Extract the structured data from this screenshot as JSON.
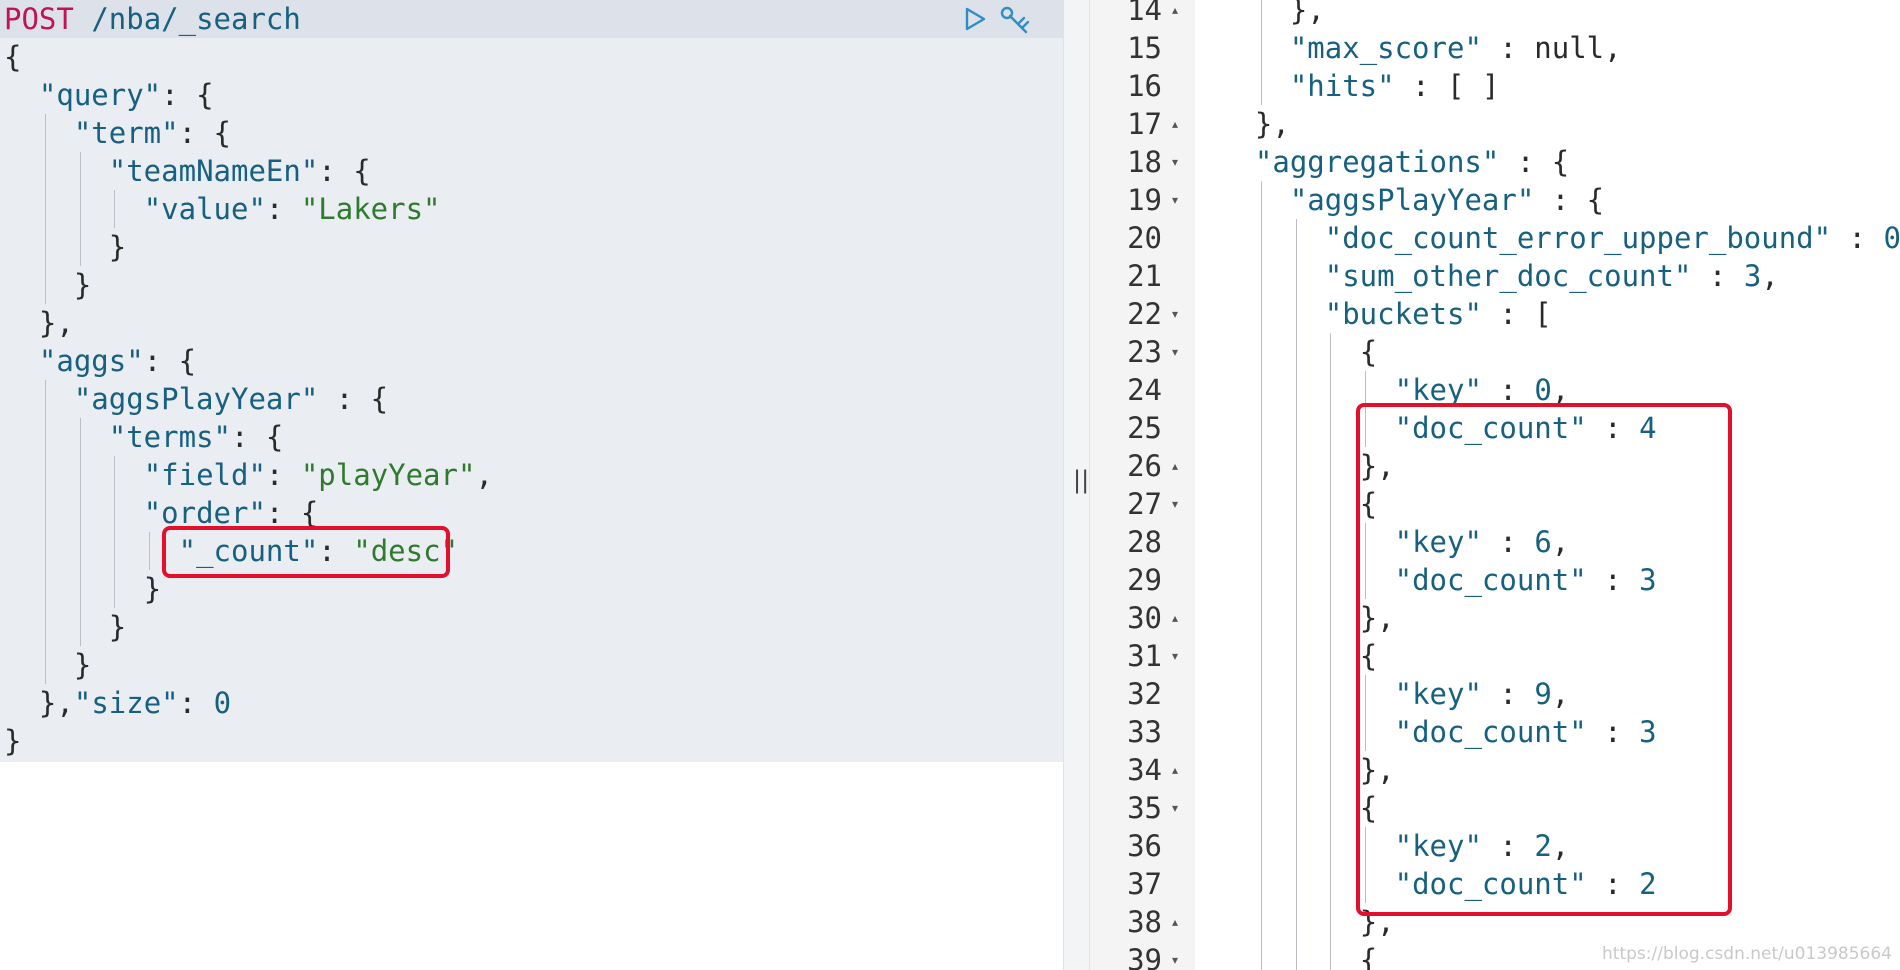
{
  "request": {
    "method": "POST",
    "path": "/nba/_search",
    "lines": [
      "{",
      "  \"query\": {",
      "    \"term\": {",
      "      \"teamNameEn\": {",
      "        \"value\": \"Lakers\"",
      "      }",
      "    }",
      "  },",
      "  \"aggs\": {",
      "    \"aggsPlayYear\" : {",
      "      \"terms\": {",
      "        \"field\": \"playYear\",",
      "        \"order\": {",
      "          \"_count\": \"desc\"",
      "        }",
      "      }",
      "    }",
      "  },\"size\": 0",
      "}"
    ]
  },
  "response": {
    "lines": [
      {
        "no": "14",
        "fold": "▴",
        "text": "    },"
      },
      {
        "no": "15",
        "fold": "",
        "text": "    \"max_score\" : null,"
      },
      {
        "no": "16",
        "fold": "",
        "text": "    \"hits\" : [ ]"
      },
      {
        "no": "17",
        "fold": "▴",
        "text": "  },"
      },
      {
        "no": "18",
        "fold": "▾",
        "text": "  \"aggregations\" : {"
      },
      {
        "no": "19",
        "fold": "▾",
        "text": "    \"aggsPlayYear\" : {"
      },
      {
        "no": "20",
        "fold": "",
        "text": "      \"doc_count_error_upper_bound\" : 0,"
      },
      {
        "no": "21",
        "fold": "",
        "text": "      \"sum_other_doc_count\" : 3,"
      },
      {
        "no": "22",
        "fold": "▾",
        "text": "      \"buckets\" : ["
      },
      {
        "no": "23",
        "fold": "▾",
        "text": "        {"
      },
      {
        "no": "24",
        "fold": "",
        "text": "          \"key\" : 0,"
      },
      {
        "no": "25",
        "fold": "",
        "text": "          \"doc_count\" : 4"
      },
      {
        "no": "26",
        "fold": "▴",
        "text": "        },"
      },
      {
        "no": "27",
        "fold": "▾",
        "text": "        {"
      },
      {
        "no": "28",
        "fold": "",
        "text": "          \"key\" : 6,"
      },
      {
        "no": "29",
        "fold": "",
        "text": "          \"doc_count\" : 3"
      },
      {
        "no": "30",
        "fold": "▴",
        "text": "        },"
      },
      {
        "no": "31",
        "fold": "▾",
        "text": "        {"
      },
      {
        "no": "32",
        "fold": "",
        "text": "          \"key\" : 9,"
      },
      {
        "no": "33",
        "fold": "",
        "text": "          \"doc_count\" : 3"
      },
      {
        "no": "34",
        "fold": "▴",
        "text": "        },"
      },
      {
        "no": "35",
        "fold": "▾",
        "text": "        {"
      },
      {
        "no": "36",
        "fold": "",
        "text": "          \"key\" : 2,"
      },
      {
        "no": "37",
        "fold": "",
        "text": "          \"doc_count\" : 2"
      },
      {
        "no": "38",
        "fold": "▴",
        "text": "        },"
      },
      {
        "no": "39",
        "fold": "▾",
        "text": "        {"
      }
    ]
  },
  "divider_glyph": "||",
  "watermark": "https://blog.csdn.net/u013985664",
  "colors": {
    "highlight": "#e30f2b",
    "method": "#c0135b",
    "key": "#17607f",
    "string": "#2f7a2e"
  },
  "icons": {
    "run": "play-triangle-icon",
    "settings": "wrench-icon"
  }
}
